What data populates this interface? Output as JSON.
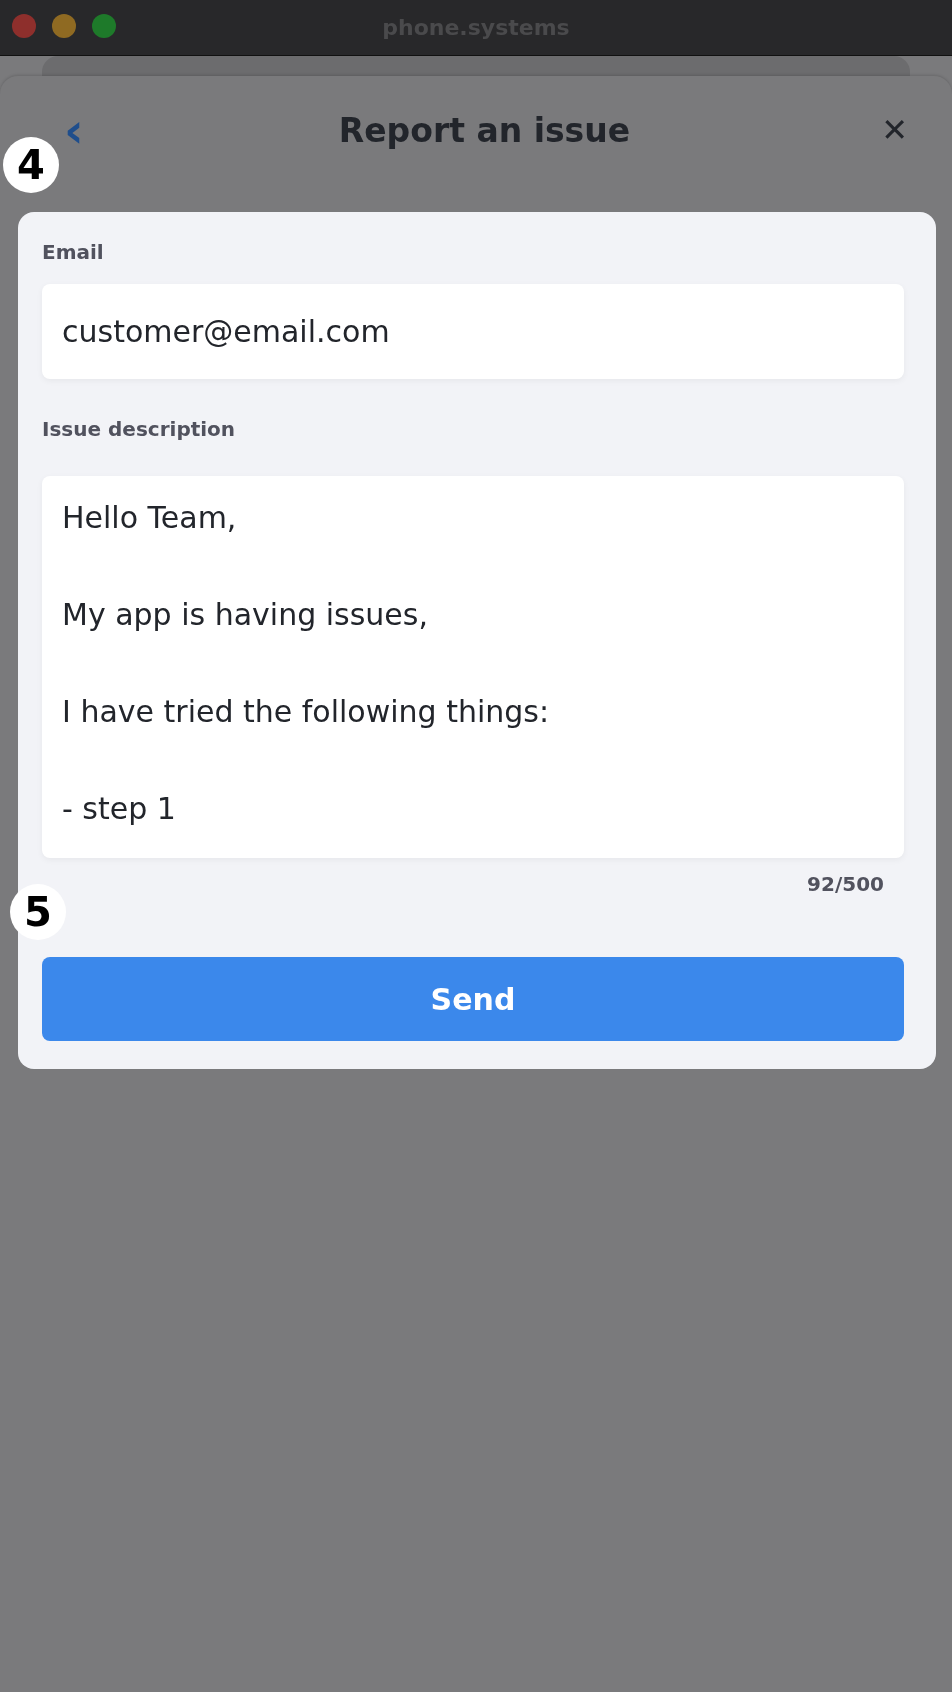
{
  "window": {
    "title": "phone.systems"
  },
  "header": {
    "back": "‹",
    "title": "Report an issue",
    "close": "✕"
  },
  "annotations": [
    {
      "label": "4"
    },
    {
      "label": "5"
    }
  ],
  "form": {
    "email_label": "Email",
    "email_value": "customer@email.com",
    "description_label": "Issue description",
    "description_paragraphs": [
      "Hello Team,",
      "My app is having issues,",
      "I have tried the following things:",
      "- step 1"
    ],
    "counter": "92/500",
    "send": "Send"
  }
}
